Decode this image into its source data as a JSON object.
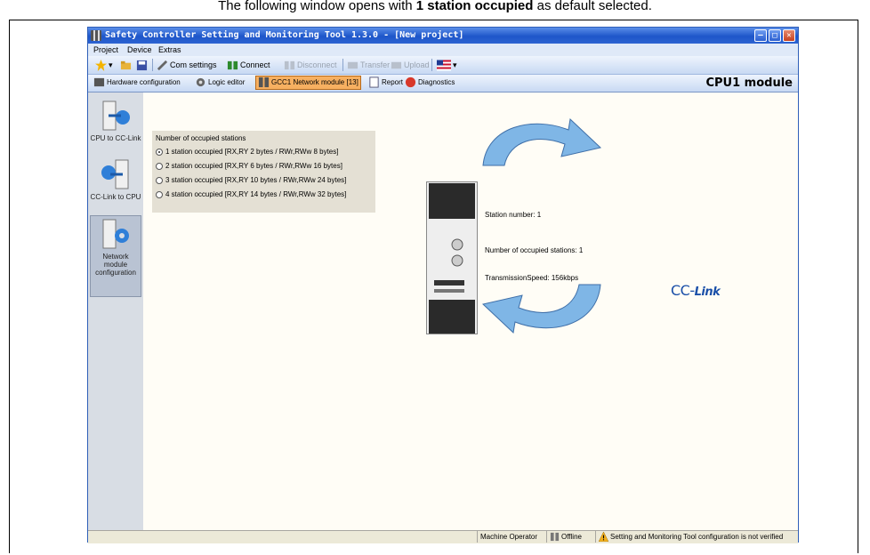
{
  "caption": {
    "prefix": "The following window opens with ",
    "bold": "1 station occupied",
    "suffix": " as default selected."
  },
  "window": {
    "title": "Safety Controller Setting and Monitoring Tool 1.3.0 - [New project]"
  },
  "menu": [
    "Project",
    "Device",
    "Extras"
  ],
  "toolbar": {
    "com_settings": "Com settings",
    "connect": "Connect",
    "disconnect": "Disconnect",
    "transfer": "Transfer",
    "upload": "Upload"
  },
  "tabs": {
    "hardware": "Hardware configuration",
    "logic": "Logic editor",
    "network": "GCC1 Network module [13]",
    "report": "Report",
    "diagnostics": "Diagnostics",
    "module_label": "CPU1 module"
  },
  "sidebar": {
    "items": [
      {
        "label": "CPU to CC-Link"
      },
      {
        "label": "CC-Link to CPU"
      },
      {
        "label": "Network module configuration"
      }
    ]
  },
  "stations": {
    "title": "Number of occupied stations",
    "selected_index": 0,
    "options": [
      "1 station occupied [RX,RY 2 bytes / RWr,RWw 8 bytes]",
      "2 station occupied [RX,RY 6 bytes / RWr,RWw 16 bytes]",
      "3 station occupied [RX,RY 10 bytes / RWr,RWw 24 bytes]",
      "4 station occupied [RX,RY 14 bytes / RWr,RWw 32 bytes]"
    ]
  },
  "info": {
    "station_number": "Station number: 1",
    "occupied": "Number of occupied stations: 1",
    "speed": "TransmissionSpeed: 156kbps"
  },
  "logo": {
    "cc": "CC-",
    "link": "Link"
  },
  "status": {
    "user": "Machine Operator",
    "connection": "Offline",
    "message": "Setting and Monitoring Tool configuration is not verified"
  }
}
